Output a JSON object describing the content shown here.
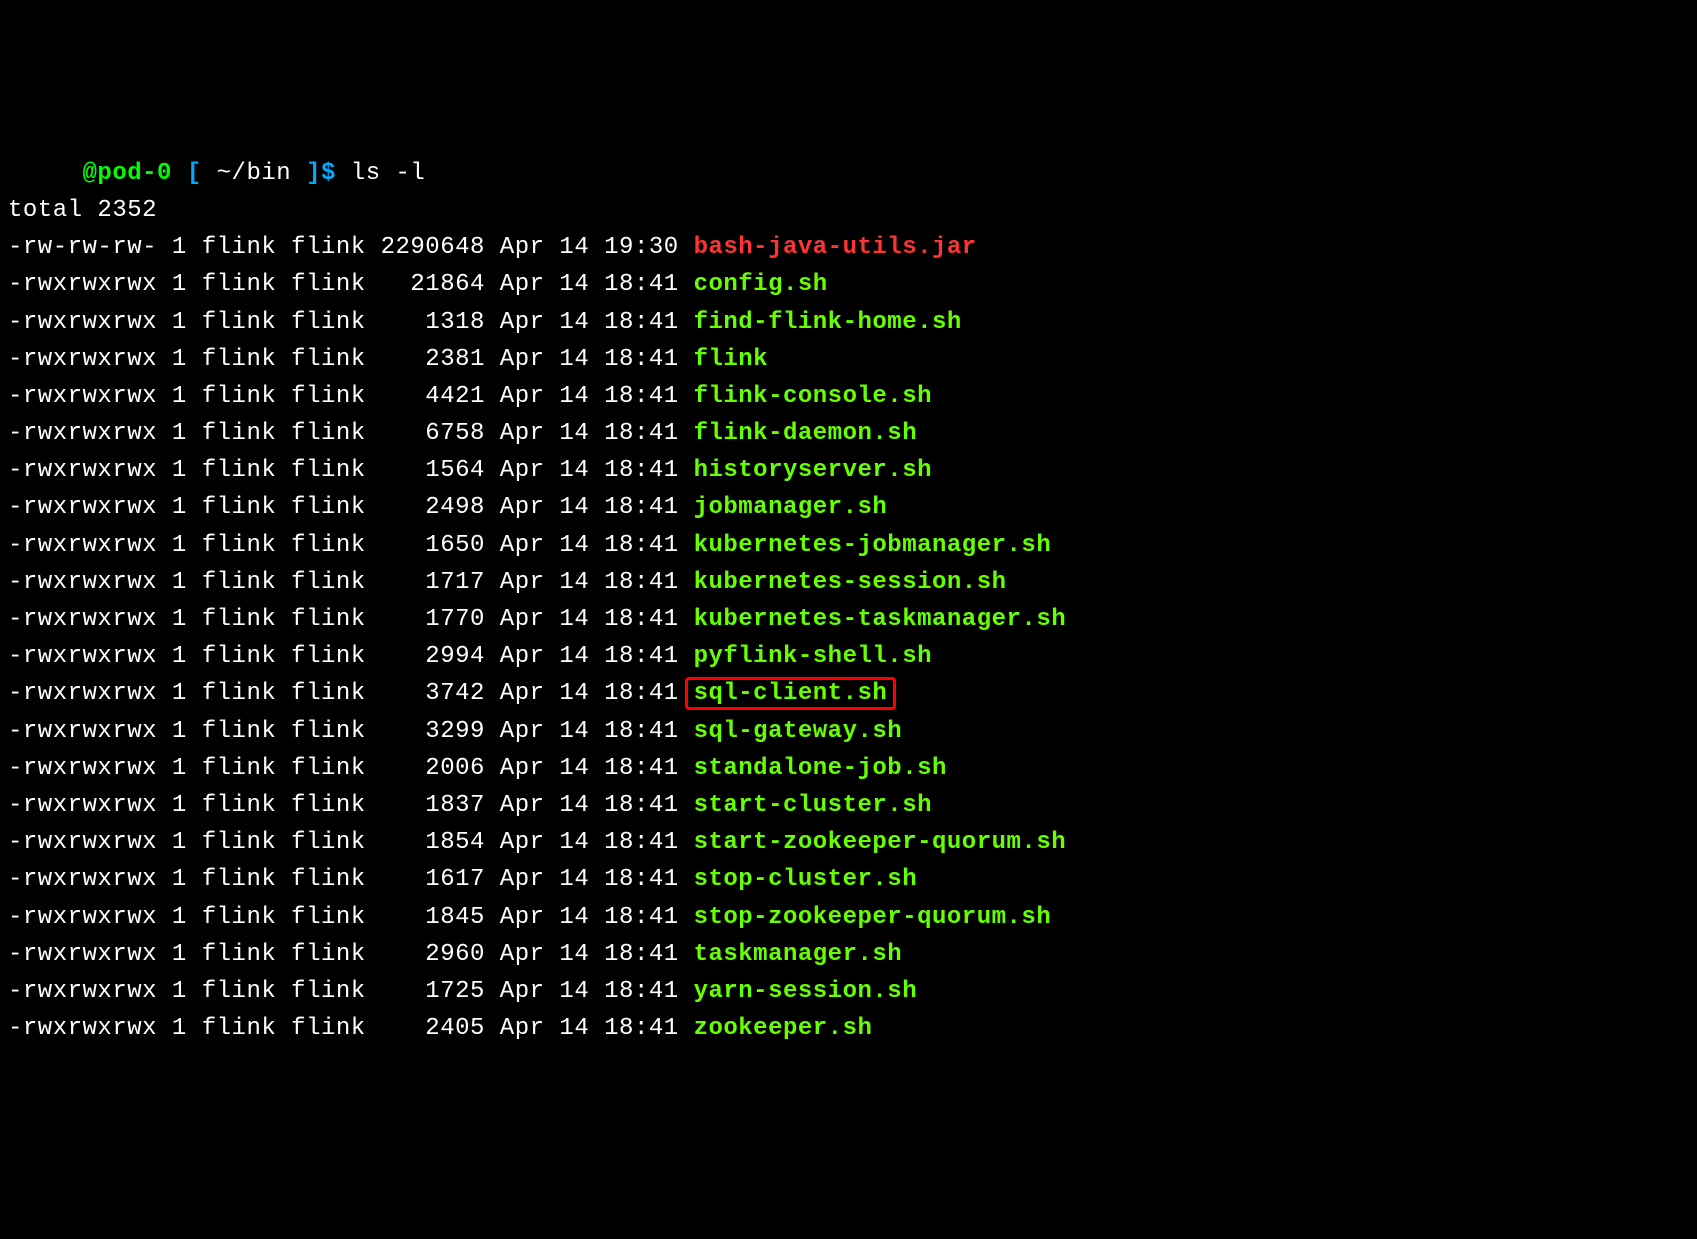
{
  "prompt": {
    "host": "@pod-0",
    "bracket_open": "[",
    "path": "~/bin",
    "bracket_close": "]",
    "dollar": "$",
    "command": "ls -l"
  },
  "total_line": "total 2352",
  "files": [
    {
      "perms": "-rw-rw-rw-",
      "links": "1",
      "owner": "flink",
      "group": "flink",
      "size": "2290648",
      "month": "Apr",
      "day": "14",
      "time": "19:30",
      "name": "bash-java-utils.jar",
      "type": "regular",
      "highlight": false
    },
    {
      "perms": "-rwxrwxrwx",
      "links": "1",
      "owner": "flink",
      "group": "flink",
      "size": "21864",
      "month": "Apr",
      "day": "14",
      "time": "18:41",
      "name": "config.sh",
      "type": "exec",
      "highlight": false
    },
    {
      "perms": "-rwxrwxrwx",
      "links": "1",
      "owner": "flink",
      "group": "flink",
      "size": "1318",
      "month": "Apr",
      "day": "14",
      "time": "18:41",
      "name": "find-flink-home.sh",
      "type": "exec",
      "highlight": false
    },
    {
      "perms": "-rwxrwxrwx",
      "links": "1",
      "owner": "flink",
      "group": "flink",
      "size": "2381",
      "month": "Apr",
      "day": "14",
      "time": "18:41",
      "name": "flink",
      "type": "exec",
      "highlight": false
    },
    {
      "perms": "-rwxrwxrwx",
      "links": "1",
      "owner": "flink",
      "group": "flink",
      "size": "4421",
      "month": "Apr",
      "day": "14",
      "time": "18:41",
      "name": "flink-console.sh",
      "type": "exec",
      "highlight": false
    },
    {
      "perms": "-rwxrwxrwx",
      "links": "1",
      "owner": "flink",
      "group": "flink",
      "size": "6758",
      "month": "Apr",
      "day": "14",
      "time": "18:41",
      "name": "flink-daemon.sh",
      "type": "exec",
      "highlight": false
    },
    {
      "perms": "-rwxrwxrwx",
      "links": "1",
      "owner": "flink",
      "group": "flink",
      "size": "1564",
      "month": "Apr",
      "day": "14",
      "time": "18:41",
      "name": "historyserver.sh",
      "type": "exec",
      "highlight": false
    },
    {
      "perms": "-rwxrwxrwx",
      "links": "1",
      "owner": "flink",
      "group": "flink",
      "size": "2498",
      "month": "Apr",
      "day": "14",
      "time": "18:41",
      "name": "jobmanager.sh",
      "type": "exec",
      "highlight": false
    },
    {
      "perms": "-rwxrwxrwx",
      "links": "1",
      "owner": "flink",
      "group": "flink",
      "size": "1650",
      "month": "Apr",
      "day": "14",
      "time": "18:41",
      "name": "kubernetes-jobmanager.sh",
      "type": "exec",
      "highlight": false
    },
    {
      "perms": "-rwxrwxrwx",
      "links": "1",
      "owner": "flink",
      "group": "flink",
      "size": "1717",
      "month": "Apr",
      "day": "14",
      "time": "18:41",
      "name": "kubernetes-session.sh",
      "type": "exec",
      "highlight": false
    },
    {
      "perms": "-rwxrwxrwx",
      "links": "1",
      "owner": "flink",
      "group": "flink",
      "size": "1770",
      "month": "Apr",
      "day": "14",
      "time": "18:41",
      "name": "kubernetes-taskmanager.sh",
      "type": "exec",
      "highlight": false
    },
    {
      "perms": "-rwxrwxrwx",
      "links": "1",
      "owner": "flink",
      "group": "flink",
      "size": "2994",
      "month": "Apr",
      "day": "14",
      "time": "18:41",
      "name": "pyflink-shell.sh",
      "type": "exec",
      "highlight": false
    },
    {
      "perms": "-rwxrwxrwx",
      "links": "1",
      "owner": "flink",
      "group": "flink",
      "size": "3742",
      "month": "Apr",
      "day": "14",
      "time": "18:41",
      "name": "sql-client.sh",
      "type": "exec",
      "highlight": true
    },
    {
      "perms": "-rwxrwxrwx",
      "links": "1",
      "owner": "flink",
      "group": "flink",
      "size": "3299",
      "month": "Apr",
      "day": "14",
      "time": "18:41",
      "name": "sql-gateway.sh",
      "type": "exec",
      "highlight": false
    },
    {
      "perms": "-rwxrwxrwx",
      "links": "1",
      "owner": "flink",
      "group": "flink",
      "size": "2006",
      "month": "Apr",
      "day": "14",
      "time": "18:41",
      "name": "standalone-job.sh",
      "type": "exec",
      "highlight": false
    },
    {
      "perms": "-rwxrwxrwx",
      "links": "1",
      "owner": "flink",
      "group": "flink",
      "size": "1837",
      "month": "Apr",
      "day": "14",
      "time": "18:41",
      "name": "start-cluster.sh",
      "type": "exec",
      "highlight": false
    },
    {
      "perms": "-rwxrwxrwx",
      "links": "1",
      "owner": "flink",
      "group": "flink",
      "size": "1854",
      "month": "Apr",
      "day": "14",
      "time": "18:41",
      "name": "start-zookeeper-quorum.sh",
      "type": "exec",
      "highlight": false
    },
    {
      "perms": "-rwxrwxrwx",
      "links": "1",
      "owner": "flink",
      "group": "flink",
      "size": "1617",
      "month": "Apr",
      "day": "14",
      "time": "18:41",
      "name": "stop-cluster.sh",
      "type": "exec",
      "highlight": false
    },
    {
      "perms": "-rwxrwxrwx",
      "links": "1",
      "owner": "flink",
      "group": "flink",
      "size": "1845",
      "month": "Apr",
      "day": "14",
      "time": "18:41",
      "name": "stop-zookeeper-quorum.sh",
      "type": "exec",
      "highlight": false
    },
    {
      "perms": "-rwxrwxrwx",
      "links": "1",
      "owner": "flink",
      "group": "flink",
      "size": "2960",
      "month": "Apr",
      "day": "14",
      "time": "18:41",
      "name": "taskmanager.sh",
      "type": "exec",
      "highlight": false
    },
    {
      "perms": "-rwxrwxrwx",
      "links": "1",
      "owner": "flink",
      "group": "flink",
      "size": "1725",
      "month": "Apr",
      "day": "14",
      "time": "18:41",
      "name": "yarn-session.sh",
      "type": "exec",
      "highlight": false
    },
    {
      "perms": "-rwxrwxrwx",
      "links": "1",
      "owner": "flink",
      "group": "flink",
      "size": "2405",
      "month": "Apr",
      "day": "14",
      "time": "18:41",
      "name": "zookeeper.sh",
      "type": "exec",
      "highlight": false
    }
  ]
}
